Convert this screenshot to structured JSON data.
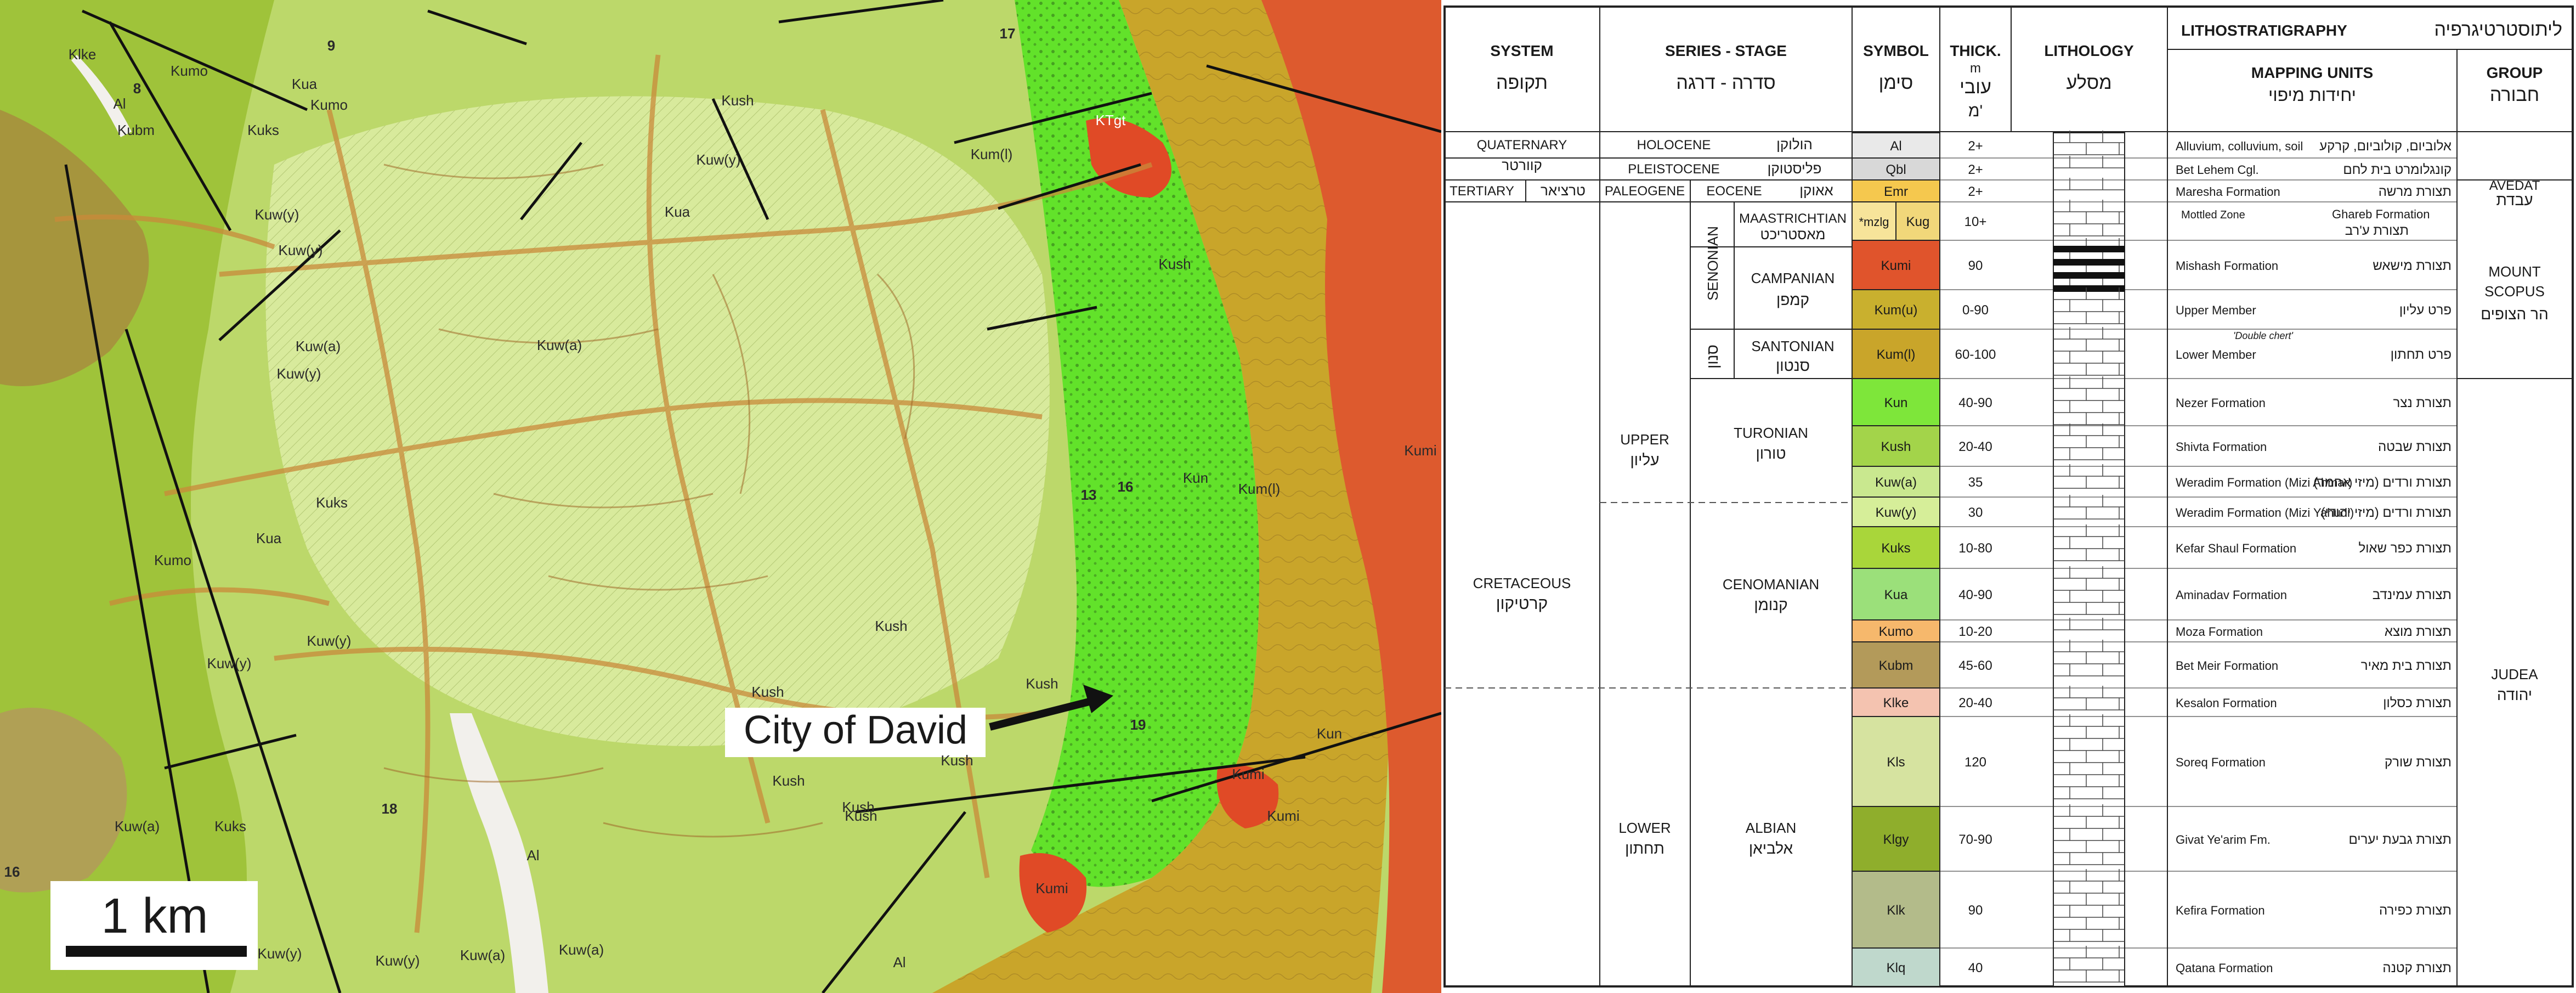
{
  "map": {
    "callout": "City of David",
    "scale_label": "1 km",
    "unit_labels": [
      {
        "label": "Klke"
      },
      {
        "label": "Kumo"
      },
      {
        "label": "Al"
      },
      {
        "label": "Kubm"
      },
      {
        "label": "Kuks"
      },
      {
        "label": "Kua"
      },
      {
        "label": "Kumo"
      },
      {
        "label": "Kuw(y)"
      },
      {
        "label": "Kuw(y)"
      },
      {
        "label": "Kuw(a)"
      },
      {
        "label": "Kuw(y)"
      },
      {
        "label": "Kuks"
      },
      {
        "label": "Kua"
      },
      {
        "label": "Kumo"
      },
      {
        "label": "Kuw(y)"
      },
      {
        "label": "Kuw(y)"
      },
      {
        "label": "Kuw(a)"
      },
      {
        "label": "Kuks"
      },
      {
        "label": "Kuw(y)"
      },
      {
        "label": "Kuw(a)"
      },
      {
        "label": "Kush"
      },
      {
        "label": "Kush"
      },
      {
        "label": "Kush"
      },
      {
        "label": "Kush"
      },
      {
        "label": "Kush"
      },
      {
        "label": "Kush"
      },
      {
        "label": "Kun"
      },
      {
        "label": "Kum(l)"
      },
      {
        "label": "Kum(l)"
      },
      {
        "label": "Kumi"
      },
      {
        "label": "Kumi"
      },
      {
        "label": "Kumi"
      },
      {
        "label": "Kumi"
      },
      {
        "label": "Kun"
      },
      {
        "label": "KTgt"
      },
      {
        "label": "Kua"
      },
      {
        "label": "Kuw(y)"
      },
      {
        "label": "Kuw(a)"
      },
      {
        "label": "Al"
      },
      {
        "label": "Al"
      },
      {
        "label": "Kush"
      },
      {
        "label": "Kush"
      },
      {
        "label": "Kush"
      },
      {
        "label": "Kuw(a)"
      },
      {
        "label": "Kuw(y)"
      }
    ],
    "numbers": [
      {
        "label": "17"
      },
      {
        "label": "9"
      },
      {
        "label": "13"
      },
      {
        "label": "16"
      },
      {
        "label": "19"
      },
      {
        "label": "18"
      },
      {
        "label": "16"
      },
      {
        "label": "8"
      }
    ]
  },
  "legend": {
    "headers": {
      "system_en": "SYSTEM",
      "system_he": "תקופה",
      "series_en": "SERIES - STAGE",
      "series_he": "סדרה - דרגה",
      "symbol_en": "SYMBOL",
      "symbol_he": "סימן",
      "thick_en": "THICK.",
      "thick_unit": "m",
      "thick_he1": "עובי",
      "thick_he2": "מ'",
      "litho_en": "LITHOLOGY",
      "litho_he": "מסלע",
      "lithostrat_en": "LITHOSTRATIGRAPHY",
      "lithostrat_he": "ליתוסטרטיגרפיה",
      "mapping_en": "MAPPING UNITS",
      "mapping_he": "יחידות מיפוי",
      "group_en": "GROUP",
      "group_he": "חבורה"
    },
    "systems": {
      "quaternary_en": "QUATERNARY",
      "quaternary_he": "קוורטר",
      "tertiary_en": "TERTIARY",
      "tertiary_he": "טרציאר",
      "cretaceous_en": "CRETACEOUS",
      "cretaceous_he": "קרטיקון"
    },
    "series": {
      "holocene_en": "HOLOCENE",
      "holocene_he": "הולוקן",
      "pleistocene_en": "PLEISTOCENE",
      "pleistocene_he": "פליסטוקן",
      "paleogene": "PALEOGENE",
      "eocene_en": "EOCENE",
      "eocene_he": "אאוקן",
      "upper_en": "UPPER",
      "upper_he": "עליון",
      "lower_en": "LOWER",
      "lower_he": "תחתון",
      "senonian_en": "SENONIAN",
      "senonian_he": "סנון",
      "maastrichtian_en": "MAASTRICHTIAN",
      "maastrichtian_he": "מאסטריכט",
      "campanian_en": "CAMPANIAN",
      "campanian_he": "קמפן",
      "santonian_en": "SANTONIAN",
      "santonian_he": "סנטון",
      "turonian_en": "TURONIAN",
      "turonian_he": "טורון",
      "cenomanian_en": "CENOMANIAN",
      "cenomanian_he": "קנומן",
      "albian_en": "ALBIAN",
      "albian_he": "אלביאן"
    },
    "groups": {
      "avedat_en": "AVEDAT",
      "avedat_he": "עבדת",
      "mount_scopus_en1": "MOUNT",
      "mount_scopus_en2": "SCOPUS",
      "mount_scopus_he": "הר הצופים",
      "judea_en": "JUDEA",
      "judea_he": "יהודה"
    },
    "rows": [
      {
        "symbol": "Al",
        "color": "#e9e9e9",
        "thick": "2+",
        "unit_en": "Alluvium, colluvium, soil",
        "unit_he": "אלוביום, קולוביום, קרקע"
      },
      {
        "symbol": "Qbl",
        "color": "#d8d8d8",
        "thick": "2+",
        "unit_en": "Bet Lehem Cgl.",
        "unit_he": "קונגלומרט בית לחם"
      },
      {
        "symbol": "Emr",
        "color": "#f5c84e",
        "thick": "2+",
        "unit_en": "Maresha Formation",
        "unit_he": "תצורת מרשה"
      },
      {
        "symbol": "Kug",
        "color": "#f1d77a",
        "thick": "10+",
        "prefix": "*mzlg",
        "unit_en": "Ghareb Formation",
        "unit_he": "תצורת ע'רב",
        "sub_en": "Mottled Zone"
      },
      {
        "symbol": "Kumi",
        "color": "#e0542c",
        "thick": "90",
        "unit_en": "Mishash Formation",
        "unit_he": "תצורת מישאש"
      },
      {
        "symbol": "Kum(u)",
        "color": "#c9b02e",
        "thick": "0-90",
        "unit_en": "Upper Member",
        "unit_he": "פרט עליון"
      },
      {
        "symbol": "Kum(l)",
        "color": "#c9a52a",
        "thick": "60-100",
        "unit_en": "Lower Member",
        "unit_he": "פרט תחתון",
        "note": "'Double chert'"
      },
      {
        "symbol": "Kun",
        "color": "#7ee63a",
        "thick": "40-90",
        "unit_en": "Nezer Formation",
        "unit_he": "תצורת נצר"
      },
      {
        "symbol": "Kush",
        "color": "#a3d44a",
        "thick": "20-40",
        "unit_en": "Shivta Formation",
        "unit_he": "תצורת שבטה"
      },
      {
        "symbol": "Kuw(a)",
        "color": "#c9e88f",
        "thick": "35",
        "unit_en": "Weradim Formation (Mizi Ahmar)",
        "unit_he": "תצורת ורדים (מיזי אחמר)"
      },
      {
        "symbol": "Kuw(y)",
        "color": "#d6ee99",
        "thick": "30",
        "unit_en": "Weradim Formation (Mizi Yahudi)",
        "unit_he": "תצורת ורדים (מיזי יהודי)"
      },
      {
        "symbol": "Kuks",
        "color": "#a9d63a",
        "thick": "10-80",
        "unit_en": "Kefar Shaul Formation",
        "unit_he": "תצורת כפר שאול"
      },
      {
        "symbol": "Kua",
        "color": "#9be07a",
        "thick": "40-90",
        "unit_en": "Aminadav Formation",
        "unit_he": "תצורת עמינדב"
      },
      {
        "symbol": "Kumo",
        "color": "#f6b86c",
        "thick": "10-20",
        "unit_en": "Moza Formation",
        "unit_he": "תצורת מוצא"
      },
      {
        "symbol": "Kubm",
        "color": "#b39a5a",
        "thick": "45-60",
        "unit_en": "Bet Meir Formation",
        "unit_he": "תצורת בית מאיר"
      },
      {
        "symbol": "Klke",
        "color": "#f4c3b0",
        "thick": "20-40",
        "unit_en": "Kesalon Formation",
        "unit_he": "תצורת כסלון"
      },
      {
        "symbol": "Kls",
        "color": "#d6e3a0",
        "thick": "120",
        "unit_en": "Soreq Formation",
        "unit_he": "תצורת שורק"
      },
      {
        "symbol": "Klgy",
        "color": "#8fae2c",
        "thick": "70-90",
        "unit_en": "Givat Ye'arim Fm.",
        "unit_he": "תצורת גבעת יערים"
      },
      {
        "symbol": "Klk",
        "color": "#b3bb8a",
        "thick": "90",
        "unit_en": "Kefira Formation",
        "unit_he": "תצורת כפירה"
      },
      {
        "symbol": "Klq",
        "color": "#bfd8cc",
        "thick": "40",
        "unit_en": "Qatana Formation",
        "unit_he": "תצורת קטנה"
      }
    ]
  }
}
